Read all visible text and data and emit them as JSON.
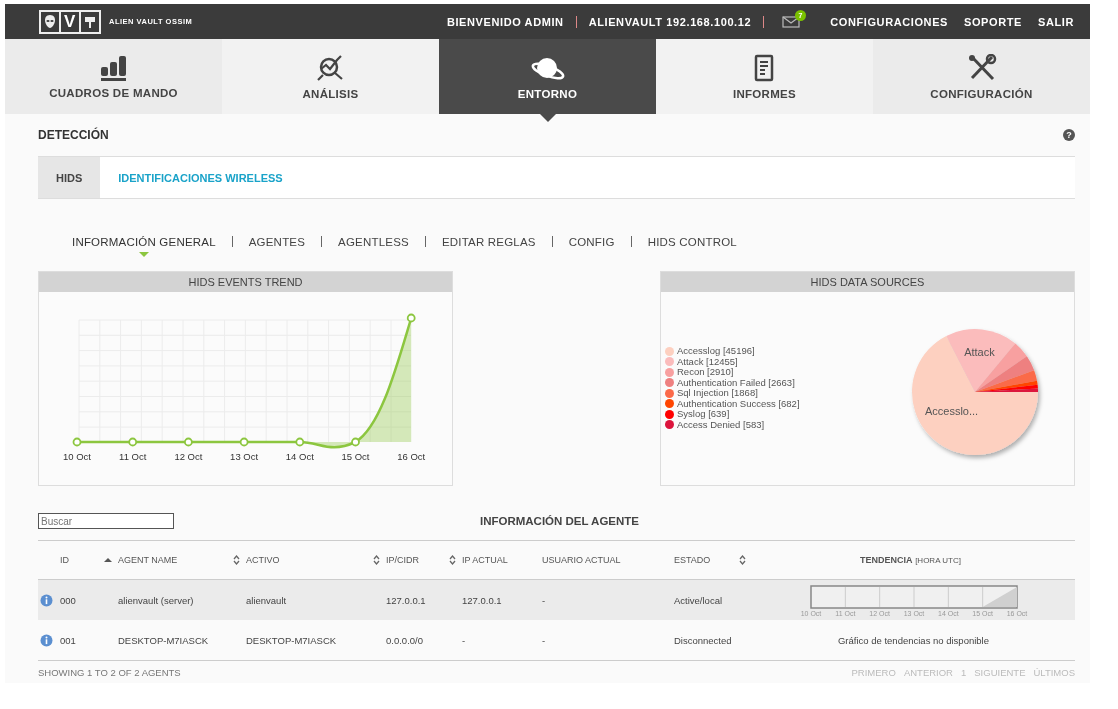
{
  "top_bar": {
    "logo_mark": "V",
    "logo_text": "ALIEN VAULT OSSIM",
    "welcome": "BIENVENIDO ADMIN",
    "host": "ALIENVAULT 192.168.100.12",
    "mail_badge": "7",
    "links": [
      "CONFIGURACIONES",
      "SOPORTE",
      "SALIR"
    ]
  },
  "nav": [
    {
      "label": "CUADROS DE MANDO",
      "selected": false
    },
    {
      "label": "ANÁLISIS",
      "selected": false
    },
    {
      "label": "ENTORNO",
      "selected": true
    },
    {
      "label": "INFORMES",
      "selected": false
    },
    {
      "label": "CONFIGURACIÓN",
      "selected": false
    }
  ],
  "section": {
    "title": "DETECCIÓN",
    "help": "?"
  },
  "tabs": [
    {
      "label": "HIDS",
      "selected": true
    },
    {
      "label": "IDENTIFICACIONES WIRELESS",
      "selected": false
    }
  ],
  "submenu": [
    {
      "label": "INFORMACIÓN GENERAL",
      "selected": true
    },
    {
      "label": "AGENTES",
      "selected": false
    },
    {
      "label": "AGENTLESS",
      "selected": false
    },
    {
      "label": "EDITAR REGLAS",
      "selected": false
    },
    {
      "label": "CONFIG",
      "selected": false
    },
    {
      "label": "HIDS CONTROL",
      "selected": false
    }
  ],
  "events_trend": {
    "title": "HIDS EVENTS TREND",
    "x_labels": [
      "10 Oct",
      "11 Oct",
      "12 Oct",
      "13 Oct",
      "14 Oct",
      "15 Oct",
      "16 Oct"
    ]
  },
  "data_sources": {
    "chart_data": {
      "type": "pie",
      "title": "HIDS DATA SOURCES",
      "values": [
        67.47,
        18.59,
        4.34,
        3.97,
        2.79,
        1.02,
        0.95,
        0.87
      ]
    },
    "legend": [
      {
        "label": "Accesslog [45196]",
        "color": "#fdd0c0"
      },
      {
        "label": "Attack [12455]",
        "color": "#fbbcbc"
      },
      {
        "label": "Recon [2910]",
        "color": "#f8a0a0"
      },
      {
        "label": "Authentication Failed [2663]",
        "color": "#ee8080"
      },
      {
        "label": "Sql Injection [1868]",
        "color": "#fb6a4a"
      },
      {
        "label": "Authentication Success [682]",
        "color": "#ff4500"
      },
      {
        "label": "Syslog [639]",
        "color": "#ff0000"
      },
      {
        "label": "Access Denied [583]",
        "color": "#dc143c"
      }
    ],
    "slice_labels": [
      "Accesslo...",
      "Attack"
    ]
  },
  "agents": {
    "search": {
      "placeholder": "Buscar"
    },
    "title": "INFORMACIÓN DEL AGENTE",
    "columns": [
      {
        "label": "ID",
        "sortable": true,
        "sorted": true
      },
      {
        "label": "AGENT NAME",
        "sortable": true,
        "sorted": false
      },
      {
        "label": "ACTIVO",
        "sortable": true,
        "sorted": false
      },
      {
        "label": "IP/CIDR",
        "sortable": true,
        "sorted": false
      },
      {
        "label": "IP ACTUAL",
        "sortable": false,
        "sorted": false
      },
      {
        "label": "USUARIO ACTUAL",
        "sortable": false,
        "sorted": false
      },
      {
        "label": "ESTADO",
        "sortable": true,
        "sorted": false
      },
      {
        "label": "TENDENCIA",
        "note": "[HORA UTC]",
        "sortable": false,
        "sorted": false
      }
    ],
    "rows": [
      {
        "highlighted": true,
        "cells": [
          "000",
          "alienvault (server)",
          "alienvault",
          "127.0.0.1",
          "127.0.0.1",
          "-",
          "Active/local"
        ],
        "trend": {
          "kind": "chart",
          "labels": [
            "10 Oct",
            "11 Oct",
            "12 Oct",
            "13 Oct",
            "14 Oct",
            "15 Oct",
            "16 Oct"
          ]
        }
      },
      {
        "highlighted": false,
        "cells": [
          "001",
          "DESKTOP-M7IASCK",
          "DESKTOP-M7IASCK",
          "0.0.0.0/0",
          "-",
          "-",
          "Disconnected"
        ],
        "trend": {
          "kind": "text",
          "text": "Gráfico de tendencias no disponible"
        }
      }
    ],
    "summary": "SHOWING 1 TO 2 OF 2 AGENTS",
    "pagination": [
      {
        "label": "PRIMERO",
        "disabled": true
      },
      {
        "label": "ANTERIOR",
        "disabled": true
      },
      {
        "label": "1",
        "disabled": true
      },
      {
        "label": "SIGUIENTE",
        "disabled": true
      },
      {
        "label": "ÚLTIMOS",
        "disabled": true
      }
    ]
  }
}
